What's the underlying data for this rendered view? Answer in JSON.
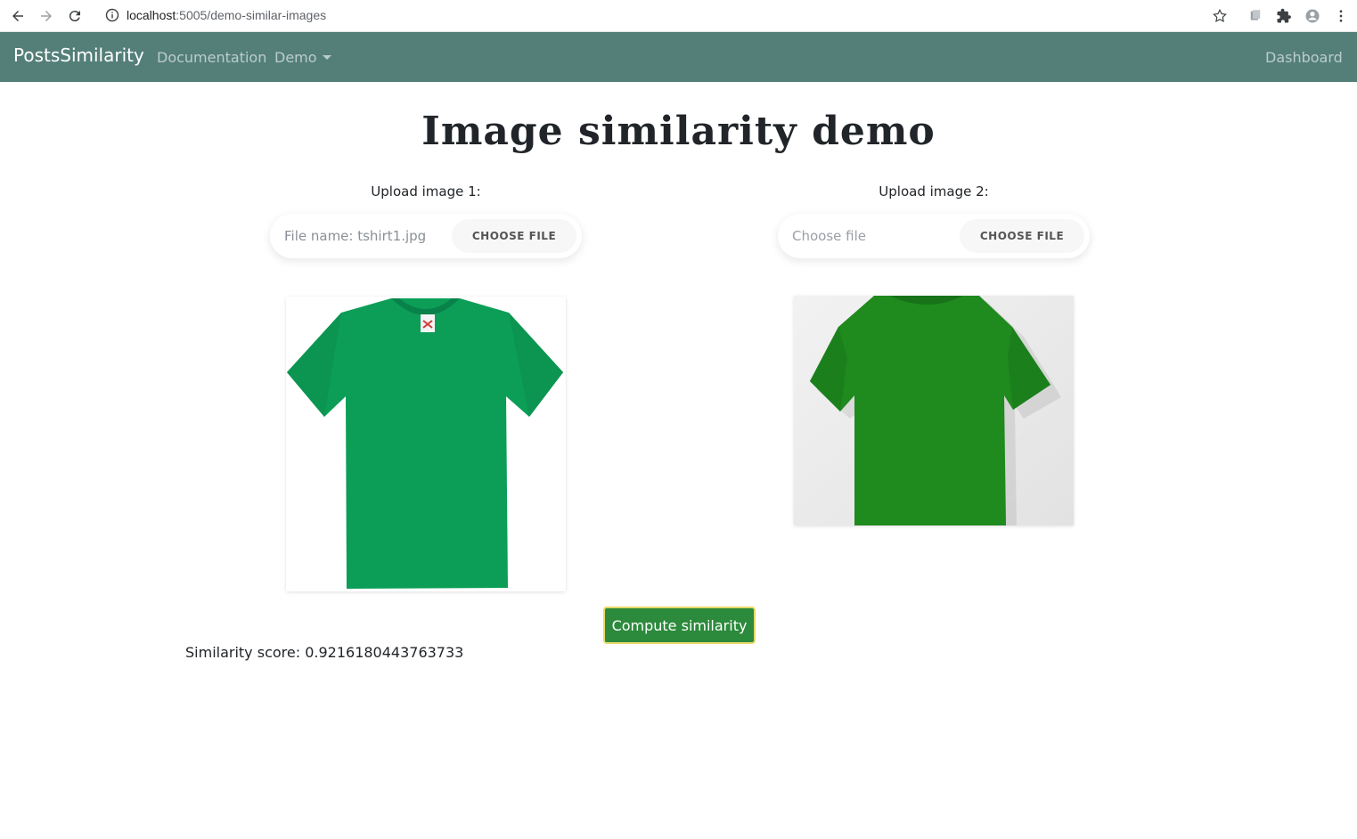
{
  "browser": {
    "url_host": "localhost",
    "url_path": ":5005/demo-similar-images",
    "icons": [
      "back-icon",
      "forward-icon",
      "reload-icon",
      "info-icon",
      "star-icon",
      "extension-icon",
      "puzzle-icon",
      "profile-icon",
      "menu-icon"
    ]
  },
  "navbar": {
    "brand": "PostsSimilarity",
    "links": {
      "documentation": "Documentation",
      "demo": "Demo",
      "dashboard": "Dashboard"
    },
    "background": "#547f79"
  },
  "main": {
    "title": "Image similarity demo",
    "upload1": {
      "label": "Upload image 1:",
      "file_text": "File name: tshirt1.jpg",
      "button": "CHOOSE FILE"
    },
    "upload2": {
      "label": "Upload image 2:",
      "file_text": "Choose file",
      "button": "CHOOSE FILE"
    },
    "compute_button": "Compute similarity",
    "score": "Similarity score: 0.9216180443763733"
  }
}
